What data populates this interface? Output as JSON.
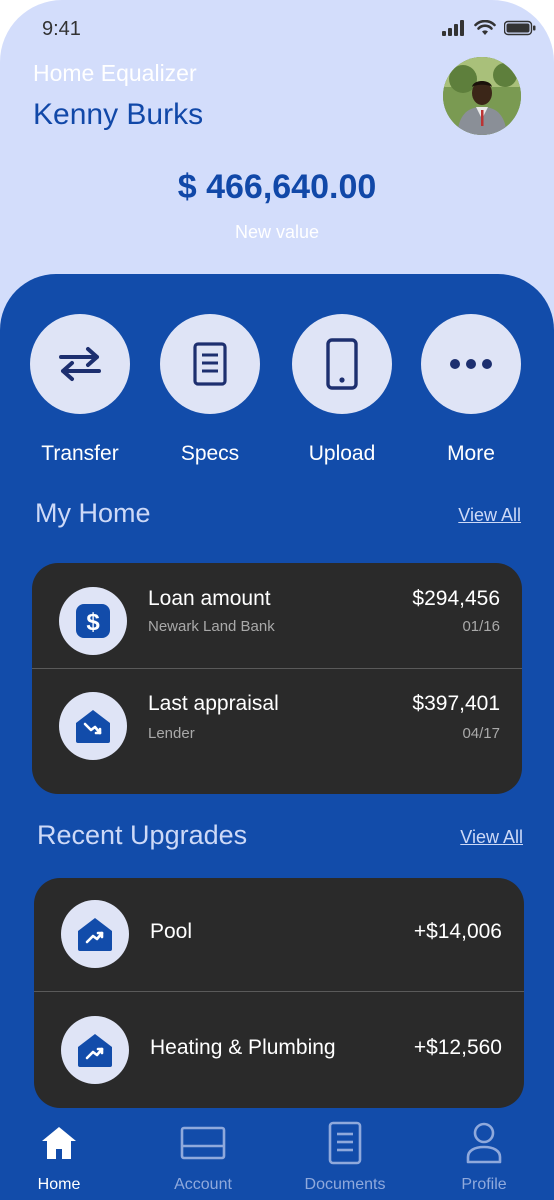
{
  "status_bar": {
    "time": "9:41"
  },
  "header": {
    "subtitle": "Home Equalizer",
    "user_name": "Kenny Burks",
    "balance": "$ 466,640.00",
    "balance_caption": "New value"
  },
  "actions": [
    {
      "label": "Transfer",
      "icon": "transfer-arrows-icon"
    },
    {
      "label": "Specs",
      "icon": "document-icon"
    },
    {
      "label": "Upload",
      "icon": "phone-icon"
    },
    {
      "label": "More",
      "icon": "more-dots-icon"
    }
  ],
  "my_home": {
    "title": "My Home",
    "view_all": "View All",
    "items": [
      {
        "title": "Loan amount",
        "subtitle": "Newark Land Bank",
        "amount": "$294,456",
        "date": "01/16",
        "icon": "dollar-icon"
      },
      {
        "title": "Last appraisal",
        "subtitle": "Lender",
        "amount": "$397,401",
        "date": "04/17",
        "icon": "house-trend-down-icon"
      }
    ]
  },
  "recent_upgrades": {
    "title": "Recent Upgrades",
    "view_all": "View All",
    "items": [
      {
        "title": "Pool",
        "amount": "+$14,006",
        "icon": "house-trend-up-icon"
      },
      {
        "title": "Heating & Plumbing",
        "amount": "+$12,560",
        "icon": "house-trend-up-icon"
      }
    ]
  },
  "bottom_nav": [
    {
      "label": "Home",
      "icon": "home-icon",
      "active": true
    },
    {
      "label": "Account",
      "icon": "card-icon",
      "active": false
    },
    {
      "label": "Documents",
      "icon": "document-icon",
      "active": false
    },
    {
      "label": "Profile",
      "icon": "person-icon",
      "active": false
    }
  ],
  "colors": {
    "header_bg": "#d3ddfb",
    "panel_bg": "#124caa",
    "card_bg": "#2a2a2a",
    "accent": "#1148a8"
  }
}
